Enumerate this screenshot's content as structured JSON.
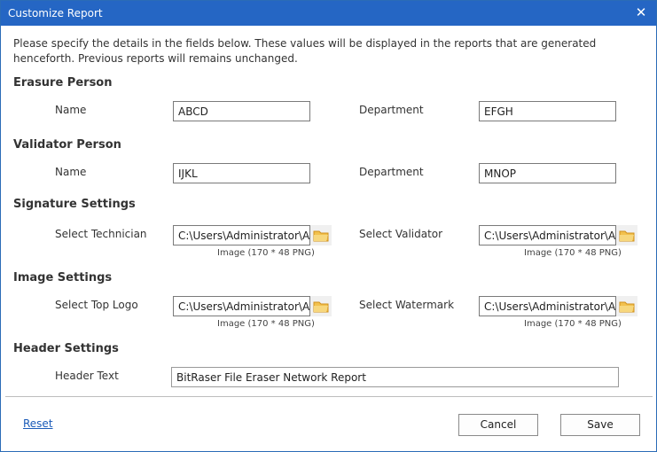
{
  "window": {
    "title": "Customize Report",
    "close_glyph": "✕"
  },
  "intro": "Please specify the details in the fields below. These values will be displayed in the reports that are generated henceforth. Previous reports will remains unchanged.",
  "erasure": {
    "heading": "Erasure Person",
    "name_label": "Name",
    "name_value": "ABCD",
    "dept_label": "Department",
    "dept_value": "EFGH"
  },
  "validator": {
    "heading": "Validator Person",
    "name_label": "Name",
    "name_value": "IJKL",
    "dept_label": "Department",
    "dept_value": "MNOP"
  },
  "signature": {
    "heading": "Signature Settings",
    "tech_label": "Select Technician",
    "tech_value": "C:\\Users\\Administrator\\A",
    "tech_hint": "Image (170 * 48 PNG)",
    "val_label": "Select Validator",
    "val_value": "C:\\Users\\Administrator\\A",
    "val_hint": "Image (170 * 48 PNG)"
  },
  "image": {
    "heading": "Image Settings",
    "logo_label": "Select Top Logo",
    "logo_value": "C:\\Users\\Administrator\\A",
    "logo_hint": "Image (170 * 48 PNG)",
    "wm_label": "Select Watermark",
    "wm_value": "C:\\Users\\Administrator\\A",
    "wm_hint": "Image (170 * 48 PNG)"
  },
  "header": {
    "heading": "Header Settings",
    "text_label": "Header Text",
    "text_value": "BitRaser File Eraser Network Report"
  },
  "footer": {
    "reset": "Reset",
    "cancel": "Cancel",
    "save": "Save"
  },
  "icons": {
    "browse": "folder-icon",
    "close": "close-icon"
  },
  "colors": {
    "titlebar": "#2566c4",
    "link": "#1a5bb8",
    "folder": "#e6a53a"
  }
}
